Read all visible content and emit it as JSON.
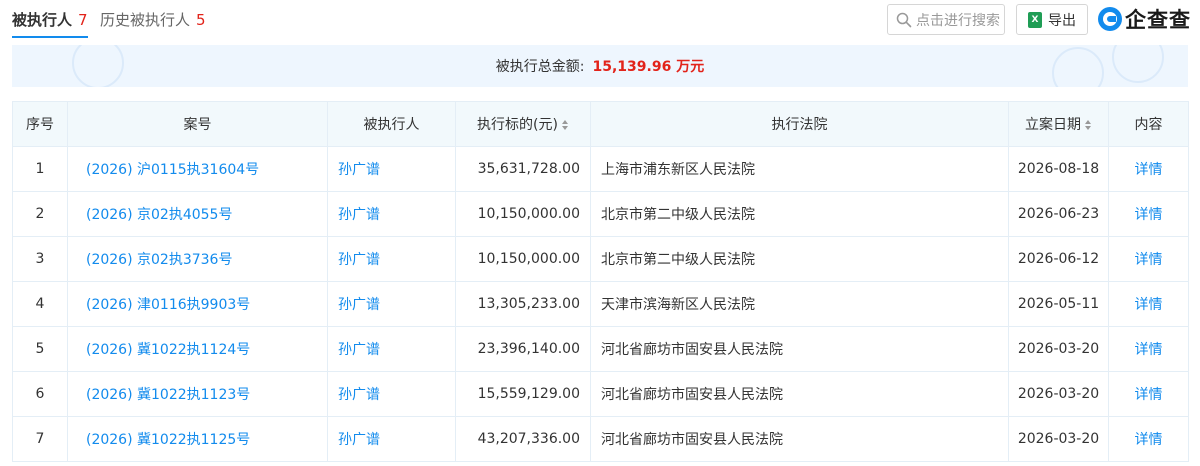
{
  "tabs": [
    {
      "label": "被执行人",
      "count": "7"
    },
    {
      "label": "历史被执行人",
      "count": "5"
    }
  ],
  "toolbar": {
    "search_label": "点击进行搜索",
    "export_label": "导出",
    "logo_text": "企查查"
  },
  "summary": {
    "label": "被执行总金额:",
    "amount": "15,139.96 万元"
  },
  "table": {
    "headers": [
      "序号",
      "案号",
      "被执行人",
      "执行标的(元)",
      "执行法院",
      "立案日期",
      "内容"
    ],
    "rows": [
      {
        "idx": "1",
        "case": "(2026) 沪0115执31604号",
        "person": "孙广谱",
        "amount": "35,631,728.00",
        "court": "上海市浦东新区人民法院",
        "date": "2026-08-18",
        "link": "详情"
      },
      {
        "idx": "2",
        "case": "(2026) 京02执4055号",
        "person": "孙广谱",
        "amount": "10,150,000.00",
        "court": "北京市第二中级人民法院",
        "date": "2026-06-23",
        "link": "详情"
      },
      {
        "idx": "3",
        "case": "(2026) 京02执3736号",
        "person": "孙广谱",
        "amount": "10,150,000.00",
        "court": "北京市第二中级人民法院",
        "date": "2026-06-12",
        "link": "详情"
      },
      {
        "idx": "4",
        "case": "(2026) 津0116执9903号",
        "person": "孙广谱",
        "amount": "13,305,233.00",
        "court": "天津市滨海新区人民法院",
        "date": "2026-05-11",
        "link": "详情"
      },
      {
        "idx": "5",
        "case": "(2026) 冀1022执1124号",
        "person": "孙广谱",
        "amount": "23,396,140.00",
        "court": "河北省廊坊市固安县人民法院",
        "date": "2026-03-20",
        "link": "详情"
      },
      {
        "idx": "6",
        "case": "(2026) 冀1022执1123号",
        "person": "孙广谱",
        "amount": "15,559,129.00",
        "court": "河北省廊坊市固安县人民法院",
        "date": "2026-03-20",
        "link": "详情"
      },
      {
        "idx": "7",
        "case": "(2026) 冀1022执1125号",
        "person": "孙广谱",
        "amount": "43,207,336.00",
        "court": "河北省廊坊市固安县人民法院",
        "date": "2026-03-20",
        "link": "详情"
      }
    ]
  },
  "colors": {
    "accent": "#128bed",
    "alert": "#e2231a",
    "header_bg": "#f2f9fc",
    "banner_bg": "#eef6fe"
  }
}
